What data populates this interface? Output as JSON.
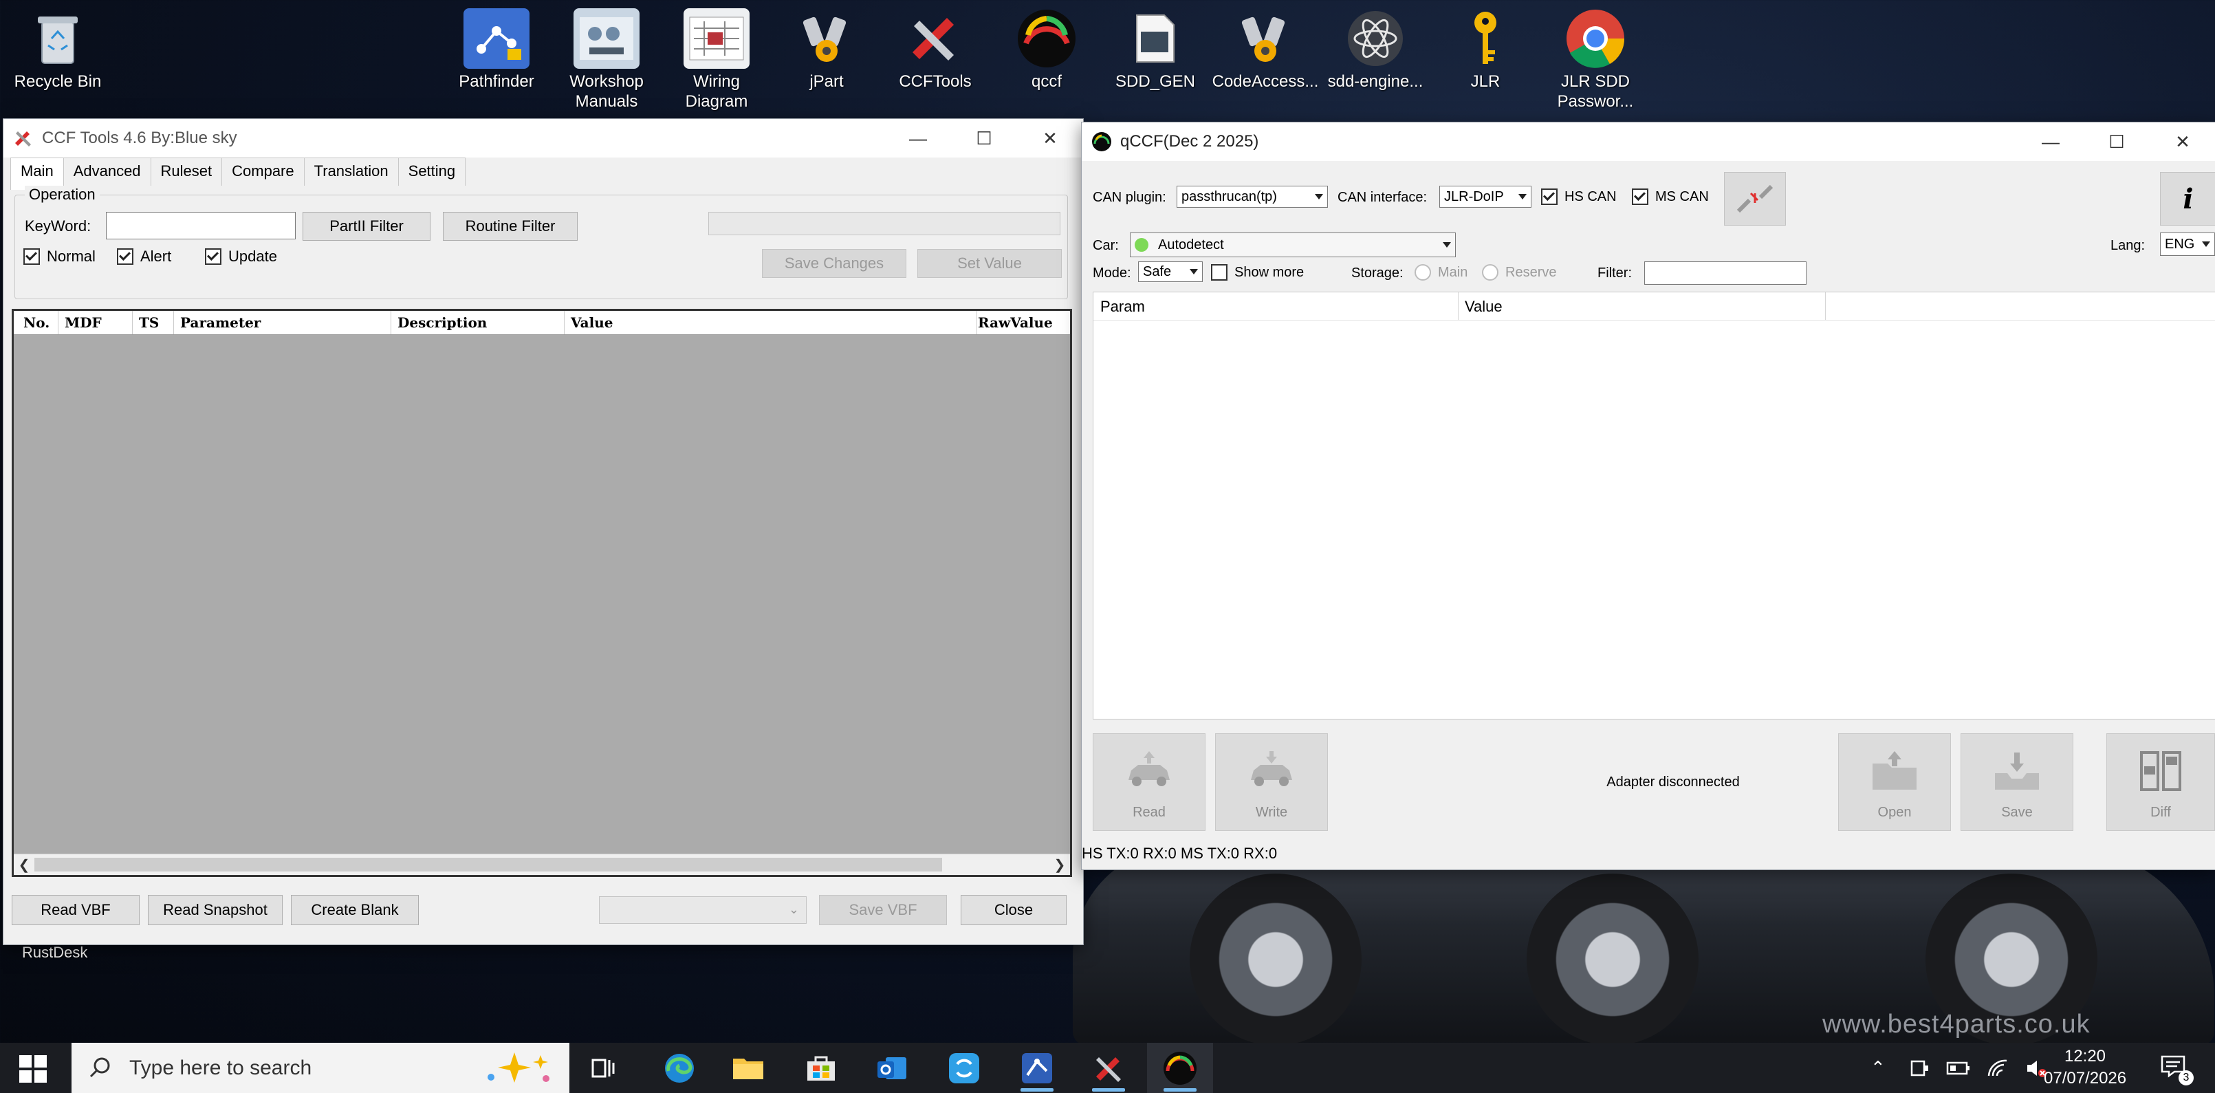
{
  "desktop": {
    "icons": [
      {
        "label": "Recycle Bin",
        "icon": "recycle-bin-icon"
      },
      {
        "label": "Pathfinder",
        "icon": "pathfinder-icon"
      },
      {
        "label": "Workshop Manuals",
        "icon": "workshop-manuals-icon"
      },
      {
        "label": "Wiring Diagram",
        "icon": "wiring-diagram-icon"
      },
      {
        "label": "jPart",
        "icon": "jpart-icon"
      },
      {
        "label": "CCFTools",
        "icon": "ccftools-icon"
      },
      {
        "label": "qccf",
        "icon": "qccf-icon"
      },
      {
        "label": "SDD_GEN",
        "icon": "sdd-gen-icon"
      },
      {
        "label": "CodeAccess...",
        "icon": "codeaccess-icon"
      },
      {
        "label": "sdd-engine...",
        "icon": "sdd-engine-icon"
      },
      {
        "label": "JLR",
        "icon": "key-icon"
      },
      {
        "label": "JLR SDD Passwor...",
        "icon": "chrome-icon"
      }
    ],
    "rustdesk_label": "RustDesk",
    "watermark": "www.best4parts.co.uk"
  },
  "ccf_window": {
    "title": "CCF Tools 4.6   By:Blue sky",
    "tabs": [
      "Main",
      "Advanced",
      "Ruleset",
      "Compare",
      "Translation",
      "Setting"
    ],
    "active_tab": "Main",
    "operation_label": "Operation",
    "keyword_label": "KeyWord:",
    "keyword_value": "",
    "partii_filter": "PartII Filter",
    "routine_filter": "Routine Filter",
    "checkboxes": [
      {
        "label": "Normal",
        "checked": true
      },
      {
        "label": "Alert",
        "checked": true
      },
      {
        "label": "Update",
        "checked": true
      }
    ],
    "save_changes": "Save Changes",
    "set_value": "Set Value",
    "columns": [
      "No.",
      "MDF",
      "TS",
      "Parameter",
      "Description",
      "Value",
      "RawValue"
    ],
    "read_vbf": "Read VBF",
    "read_snapshot": "Read Snapshot",
    "create_blank": "Create Blank",
    "save_vbf": "Save VBF",
    "close": "Close"
  },
  "qccf_window": {
    "title": "qCCF(Dec  2 2025)",
    "can_plugin_label": "CAN plugin:",
    "can_plugin_value": "passthrucan(tp)",
    "can_interface_label": "CAN interface:",
    "can_interface_value": "JLR-DoIP",
    "hs_can": {
      "label": "HS CAN",
      "checked": true
    },
    "ms_can": {
      "label": "MS CAN",
      "checked": true
    },
    "car_label": "Car:",
    "car_value": "Autodetect",
    "car_status_color": "#7ed957",
    "lang_label": "Lang:",
    "lang_value": "ENG",
    "mode_label": "Mode:",
    "mode_value": "Safe",
    "show_more": {
      "label": "Show more",
      "checked": false
    },
    "storage_label": "Storage:",
    "storage_main": "Main",
    "storage_reserve": "Reserve",
    "filter_label": "Filter:",
    "filter_value": "",
    "columns": [
      "Param",
      "Value"
    ],
    "buttons": {
      "read": "Read",
      "write": "Write",
      "open": "Open",
      "save": "Save",
      "diff": "Diff"
    },
    "adapter_status": "Adapter disconnected",
    "bus_status": "HS TX:0 RX:0  MS TX:0 RX:0"
  },
  "taskbar": {
    "search_placeholder": "Type here to search",
    "apps": [
      "task-view-icon",
      "edge-icon",
      "file-explorer-icon",
      "store-icon",
      "outlook-icon",
      "rustdesk-icon",
      "pathfinder-icon",
      "ccftools-icon",
      "qccf-icon"
    ],
    "time": "12:20",
    "date": "07/07/2026",
    "notification_count": "3"
  }
}
